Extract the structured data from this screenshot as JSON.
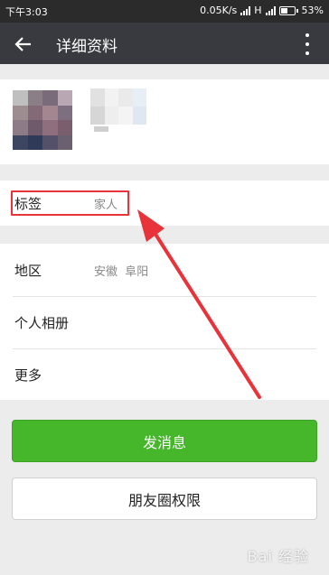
{
  "status_bar": {
    "time": "下午3:03",
    "network_speed": "0.05K/s",
    "network_type": "H",
    "battery": "53%",
    "battery_level": 0.53
  },
  "app_bar": {
    "title": "详细资料",
    "back_icon": "arrow-left-icon",
    "more_icon": "more-vertical-icon"
  },
  "tag_row": {
    "label": "标签",
    "value": "家人"
  },
  "info": {
    "rows": [
      {
        "label": "地区",
        "value": "安徽  阜阳"
      },
      {
        "label": "个人相册",
        "value": ""
      },
      {
        "label": "更多",
        "value": ""
      }
    ]
  },
  "buttons": {
    "send_message": "发消息",
    "moments_permission": "朋友圈权限"
  },
  "colors": {
    "primary_green": "#46b62a",
    "annotation_red": "#e8333a",
    "app_bar": "#393a3f"
  },
  "watermark": {
    "text": "Bai 经验"
  }
}
